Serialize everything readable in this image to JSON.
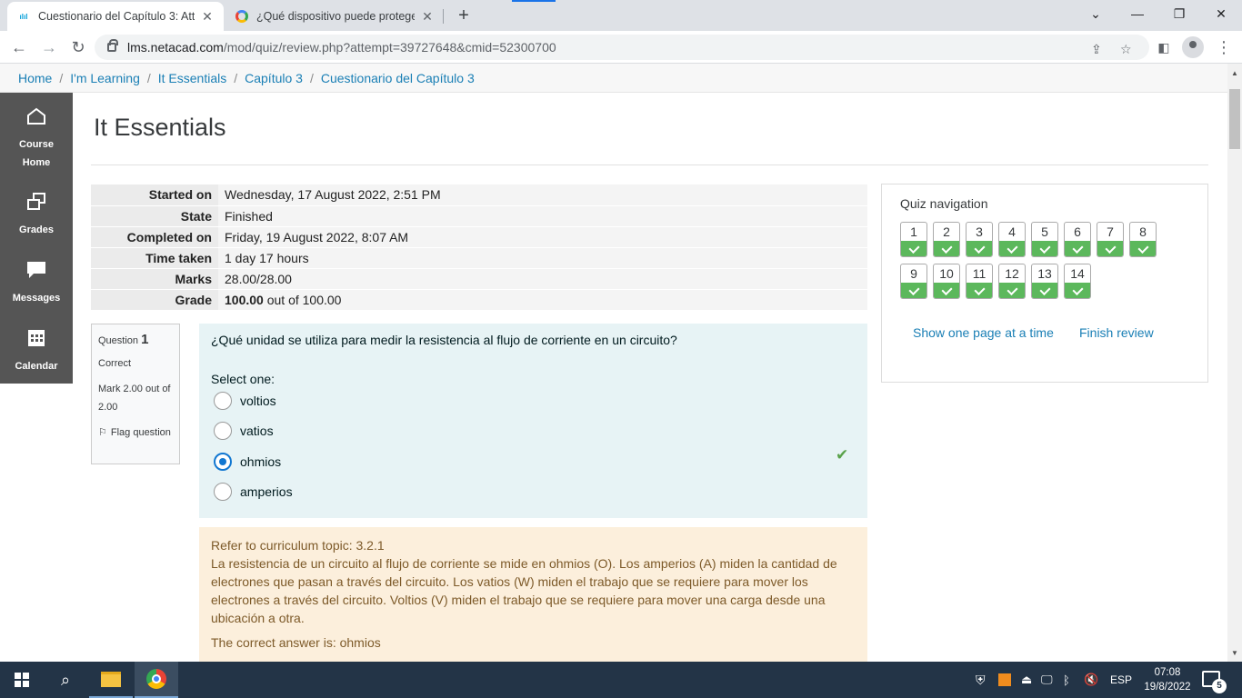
{
  "browser": {
    "tabs": [
      {
        "title": "Cuestionario del Capítulo 3: Atte",
        "favicon": "cisco-icon",
        "active": true
      },
      {
        "title": "¿Qué dispositivo puede proteger",
        "favicon": "google-icon",
        "active": false
      }
    ],
    "url_host": "lms.netacad.com",
    "url_path": "/mod/quiz/review.php?attempt=39727648&cmid=52300700"
  },
  "breadcrumb": [
    "Home",
    "I'm Learning",
    "It Essentials",
    "Capítulo 3",
    "Cuestionario del Capítulo 3"
  ],
  "sidebar": {
    "items": [
      {
        "label_1": "Course",
        "label_2": "Home",
        "icon": "home-icon"
      },
      {
        "label_1": "Grades",
        "icon": "grades-icon"
      },
      {
        "label_1": "Messages",
        "icon": "messages-icon"
      },
      {
        "label_1": "Calendar",
        "icon": "calendar-icon"
      }
    ]
  },
  "page": {
    "title": "It Essentials"
  },
  "summary": [
    {
      "key": "Started on",
      "value": "Wednesday, 17 August 2022, 2:51 PM"
    },
    {
      "key": "State",
      "value": "Finished"
    },
    {
      "key": "Completed on",
      "value": "Friday, 19 August 2022, 8:07 AM"
    },
    {
      "key": "Time taken",
      "value": "1 day 17 hours"
    },
    {
      "key": "Marks",
      "value": "28.00/28.00"
    },
    {
      "key": "Grade",
      "value_bold": "100.00",
      "value_rest": " out of 100.00"
    }
  ],
  "question": {
    "label": "Question",
    "number": "1",
    "status": "Correct",
    "mark": "Mark 2.00 out of 2.00",
    "flag": "Flag question",
    "text": "¿Qué unidad se utiliza para medir la resistencia al flujo de corriente en un circuito?",
    "prompt": "Select one:",
    "options": [
      {
        "label": "voltios",
        "selected": false
      },
      {
        "label": "vatios",
        "selected": false
      },
      {
        "label": "ohmios",
        "selected": true
      },
      {
        "label": "amperios",
        "selected": false
      }
    ]
  },
  "feedback": {
    "topic": "Refer to curriculum topic: 3.2.1",
    "explanation": "La resistencia de un circuito al flujo de corriente se mide en ohmios (O). Los amperios (A) miden la cantidad de electrones que pasan a través del circuito. Los vatios (W) miden el trabajo que se requiere para mover los electrones a través del circuito. Voltios (V) miden el trabajo que se requiere para mover una carga desde una ubicación a otra.",
    "correct": "The correct answer is: ohmios"
  },
  "quiz_nav": {
    "title": "Quiz navigation",
    "questions": [
      "1",
      "2",
      "3",
      "4",
      "5",
      "6",
      "7",
      "8",
      "9",
      "10",
      "11",
      "12",
      "13",
      "14"
    ],
    "show_one_page": "Show one page at a time",
    "finish_review": "Finish review",
    "status_color": "#5cb85c"
  },
  "taskbar": {
    "lang": "ESP",
    "time": "07:08",
    "date": "19/8/2022",
    "notifications": "5"
  }
}
